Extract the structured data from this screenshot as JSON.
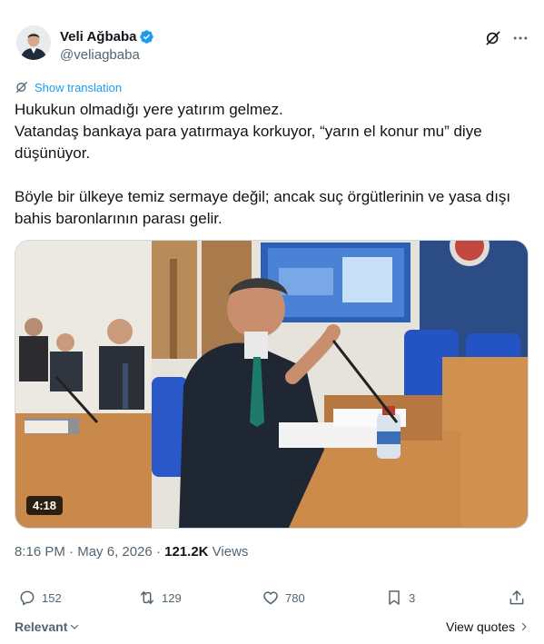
{
  "author": {
    "display_name": "Veli Ağbaba",
    "handle": "@veliagbaba",
    "verified": true
  },
  "icons": {
    "verified": "verified-badge-icon",
    "grok": "grok-icon",
    "more": "more-horizontal-icon",
    "translate": "translate-icon"
  },
  "translate_label": "Show translation",
  "text": {
    "line1": "Hukukun olmadığı yere yatırım gelmez.",
    "line2": "Vatandaş bankaya para yatırmaya korkuyor, “yarın el konur mu” diye düşünüyor.",
    "line3": "Böyle bir ülkeye temiz sermaye değil; ancak suç örgütlerinin ve yasa dışı bahis baronlarının parası gelir."
  },
  "media": {
    "duration": "4:18"
  },
  "meta": {
    "time": "8:16 PM",
    "separator": " · ",
    "date": "May 6, 2026",
    "views_count": "121.2K",
    "views_label": " Views"
  },
  "actions": {
    "replies": "152",
    "reposts": "129",
    "likes": "780",
    "bookmarks": "3"
  },
  "footer": {
    "sort_label": "Relevant",
    "view_quotes": "View quotes"
  },
  "colors": {
    "accent": "#1d9bf0",
    "text": "#0f1419",
    "secondary": "#536471"
  }
}
